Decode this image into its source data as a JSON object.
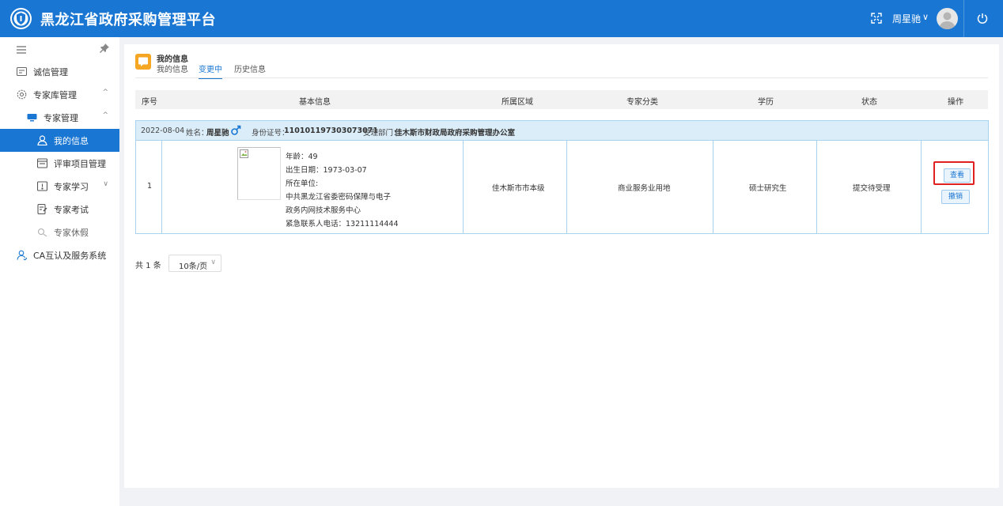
{
  "header": {
    "title": "黑龙江省政府采购管理平台",
    "user_name": "周星驰",
    "user_chevron": "∨"
  },
  "sidebar": {
    "items": [
      {
        "label": "诚信管理",
        "icon": "credit-icon"
      },
      {
        "label": "专家库管理",
        "icon": "settings-icon",
        "chevron": "^"
      },
      {
        "label": "专家管理",
        "icon": "monitor-icon",
        "chevron": "^"
      },
      {
        "label": "我的信息",
        "icon": "user-icon",
        "active": true
      },
      {
        "label": "评审项目管理",
        "icon": "window-icon"
      },
      {
        "label": "专家学习",
        "icon": "book-icon",
        "chevron": "∨"
      },
      {
        "label": "专家考试",
        "icon": "exam-icon"
      },
      {
        "label": "专家休假",
        "icon": "vacation-icon"
      },
      {
        "label": "CA互认及服务系统",
        "icon": "ca-user-icon"
      }
    ]
  },
  "panel": {
    "title": "我的信息",
    "tabs": [
      "我的信息",
      "变更中",
      "历史信息"
    ],
    "active_tab": "变更中"
  },
  "table": {
    "columns": [
      "序号",
      "基本信息",
      "所属区域",
      "专家分类",
      "学历",
      "状态",
      "操作"
    ],
    "rows": [
      {
        "date": "2022-08-04",
        "name_label": "姓名：",
        "name": "周星驰",
        "id_label": "身份证号：",
        "id_number": "110101197303073071",
        "dept_label": "受理部门：",
        "dept": "佳木斯市财政局政府采购管理办公室",
        "index": "1",
        "age_line": "年龄：49",
        "birth_line": "出生日期：1973-03-07",
        "unit_label": "所在单位:",
        "unit_line1": "中共黑龙江省委密码保障与电子",
        "unit_line2": "政务内网技术服务中心",
        "phone_line": "紧急联系人电话：13211114444",
        "region": "佳木斯市市本级",
        "category": "商业服务业用地",
        "education": "硕士研究生",
        "status": "提交待受理",
        "view_label": "查看",
        "revoke_label": "撤销"
      }
    ]
  },
  "pagination": {
    "total": "共 1 条",
    "page_size": "10条/页",
    "chevron": "∨"
  },
  "colors": {
    "primary": "#1976d2",
    "badge": "#f5a623",
    "highlight": "#e02020",
    "record_bg": "#dbedf8"
  }
}
